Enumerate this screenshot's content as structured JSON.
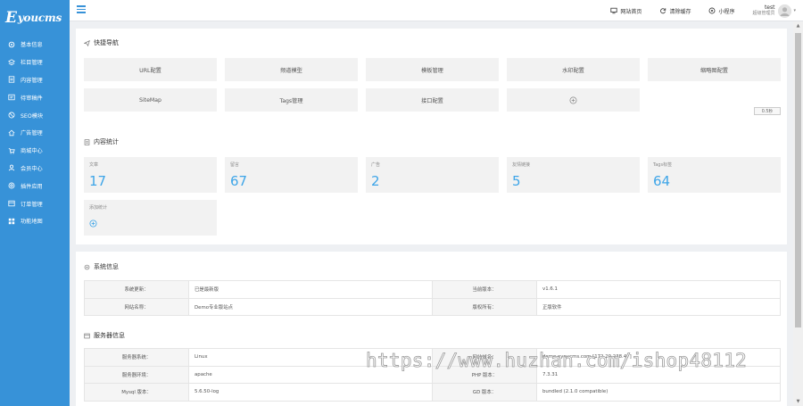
{
  "sidebar": {
    "logo": {
      "big": "E",
      "rest": "youcms"
    },
    "items": [
      {
        "label": "基本信息",
        "icon": "gear-icon"
      },
      {
        "label": "栏目管理",
        "icon": "layers-icon"
      },
      {
        "label": "内容管理",
        "icon": "document-icon"
      },
      {
        "label": "待审稿件",
        "icon": "pending-icon"
      },
      {
        "label": "SEO模块",
        "icon": "seo-icon"
      },
      {
        "label": "广告管理",
        "icon": "home-icon"
      },
      {
        "label": "商城中心",
        "icon": "cart-icon"
      },
      {
        "label": "会员中心",
        "icon": "user-icon"
      },
      {
        "label": "插件应用",
        "icon": "plugin-icon"
      },
      {
        "label": "订单管理",
        "icon": "order-icon"
      },
      {
        "label": "功能地图",
        "icon": "grid-icon"
      }
    ]
  },
  "topbar": {
    "links": [
      {
        "label": "网站首页",
        "icon": "monitor-icon"
      },
      {
        "label": "清除缓存",
        "icon": "refresh-icon"
      },
      {
        "label": "小程序",
        "icon": "miniapp-icon"
      }
    ],
    "user": {
      "name": "test",
      "role": "超级管理员"
    }
  },
  "quick_nav": {
    "title": "快捷导航",
    "buttons": [
      "URL配置",
      "频道模型",
      "模板管理",
      "水印配置",
      "缩略图配置",
      "SiteMap",
      "Tags管理",
      "接口配置"
    ],
    "timer": "0.5秒"
  },
  "stats": {
    "title": "内容统计",
    "items": [
      {
        "label": "文章",
        "value": "17"
      },
      {
        "label": "留言",
        "value": "67"
      },
      {
        "label": "广告",
        "value": "2"
      },
      {
        "label": "友情链接",
        "value": "5"
      },
      {
        "label": "Tags标签",
        "value": "64"
      }
    ],
    "add_label": "添加统计"
  },
  "system_info": {
    "title": "系统信息",
    "rows": [
      [
        "系统更新：",
        "已是最新版",
        "当前版本：",
        "v1.6.1"
      ],
      [
        "网站名称：",
        "Demo专业版站点",
        "版权所有：",
        "正版软件"
      ]
    ]
  },
  "server_info": {
    "title": "服务器信息",
    "rows": [
      [
        "服务器系统：",
        "Linux",
        "网站域名：",
        "demo.eyoucms.com [172.20.238.47]"
      ],
      [
        "服务器环境：",
        "apache",
        "PHP 版本：",
        "7.3.31"
      ],
      [
        "Mysql 版本：",
        "5.6.50-log",
        "GD 版本：",
        "bundled (2.1.0 compatible)"
      ]
    ]
  },
  "watermark": "https://www.huzhan.com/ishop48112",
  "colors": {
    "sidebar": "#3792d8",
    "accent": "#3ea5e8"
  }
}
